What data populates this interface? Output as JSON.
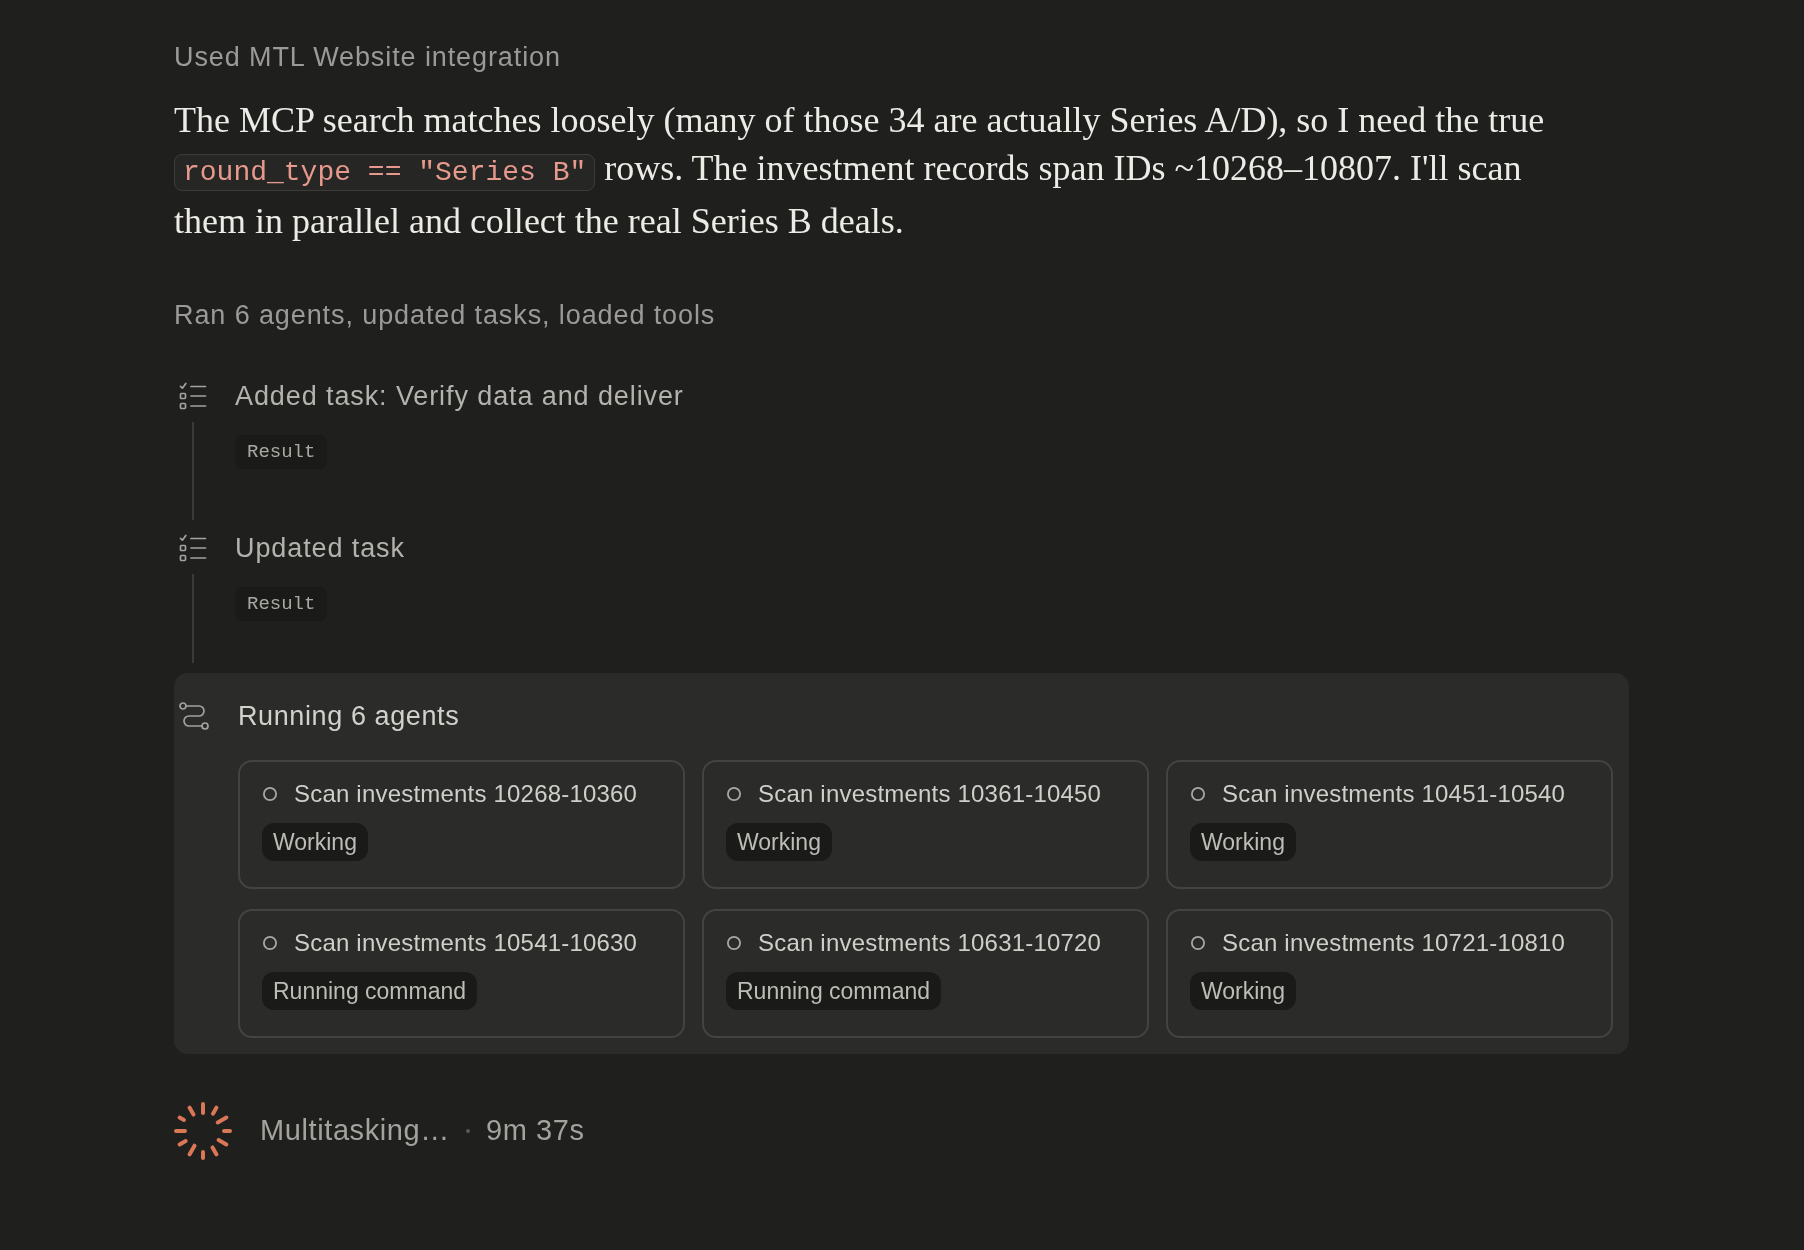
{
  "integration_note": "Used MTL Website integration",
  "message": [
    {
      "kind": "text",
      "text": "The MCP search matches loosely (many of those 34 are actually Series A/D), so I need the true "
    },
    {
      "kind": "code",
      "text": "round_type == \"Series B\""
    },
    {
      "kind": "text",
      "text": " rows. The investment records span IDs ~10268–10807. I'll scan them in parallel and collect the real Series B deals."
    }
  ],
  "activity_summary": "Ran 6 agents, updated tasks, loaded tools",
  "steps": [
    {
      "title": "Added task: Verify data and deliver",
      "result": "Result"
    },
    {
      "title": "Updated task",
      "result": "Result"
    }
  ],
  "agents_panel": {
    "title": "Running 6 agents",
    "agents": [
      {
        "name": "Scan investments 10268-10360",
        "status": "Working"
      },
      {
        "name": "Scan investments 10361-10450",
        "status": "Working"
      },
      {
        "name": "Scan investments 10451-10540",
        "status": "Working"
      },
      {
        "name": "Scan investments 10541-10630",
        "status": "Running command"
      },
      {
        "name": "Scan investments 10631-10720",
        "status": "Running command"
      },
      {
        "name": "Scan investments 10721-10810",
        "status": "Working"
      }
    ]
  },
  "status": {
    "label": "Multitasking…",
    "elapsed": "9m 37s"
  }
}
